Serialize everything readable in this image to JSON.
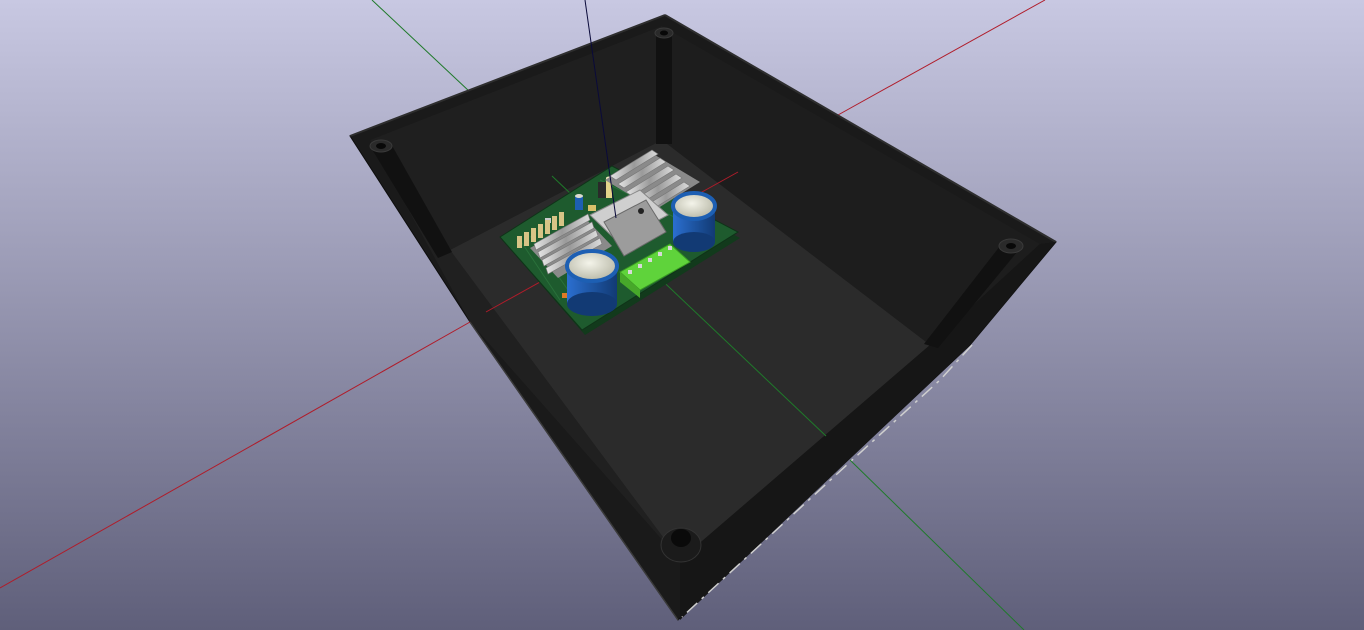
{
  "viewer": {
    "background_top": "#c8c8e2",
    "background_bottom": "#5f5f7a"
  },
  "axes": {
    "x_color": "#b01c2a",
    "y_color": "#1f7a2a",
    "z_color": "#0a0a3a"
  },
  "enclosure": {
    "color": "#1c1c1c",
    "floor_color": "#2b2b2b"
  },
  "board": {
    "pcb_color": "#1e5b2e",
    "capacitor_color": "#1d5fb3",
    "heatsink_color": "#bcbcbc",
    "terminal_color": "#5fd33b"
  }
}
